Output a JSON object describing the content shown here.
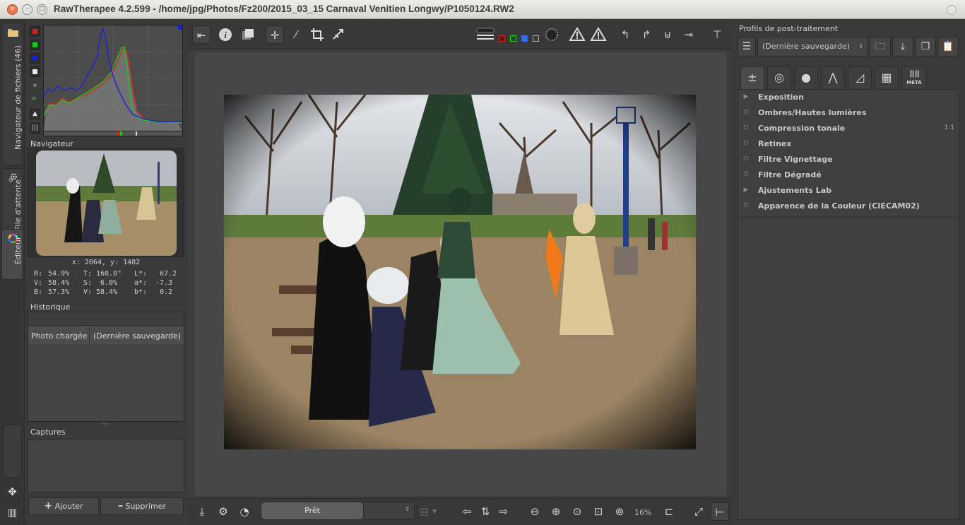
{
  "window": {
    "title": "RawTherapee 4.2.599 - /home/jpg/Photos/Fz200/2015_03_15 Carnaval Venitien Longwy/P1050124.RW2",
    "close_glyph": "×",
    "minimize_glyph": "–",
    "maximize_glyph": "□"
  },
  "vertical_tabs": [
    {
      "label": "Navigateur de fichiers  (46)",
      "icon": "folder-icon"
    },
    {
      "label": "File d'attente",
      "icon": "gears-icon"
    },
    {
      "label": "Éditeur",
      "icon": "color-wheel-icon"
    }
  ],
  "left_panel": {
    "navigator_title": "Navigateur",
    "coords": "x: 2064, y: 1482",
    "info": [
      [
        "R:",
        "54.9%",
        "T:",
        "160.0°",
        "L*:",
        "67.2"
      ],
      [
        "V:",
        "58.4%",
        "S:",
        "6.0%",
        "a*:",
        "-7.3"
      ],
      [
        "B:",
        "57.3%",
        "V:",
        "58.4%",
        "b*:",
        "0.2"
      ]
    ],
    "history_title": "Historique",
    "history_rows": [
      {
        "action": "Photo chargée",
        "value": "(Dernière sauvegarde)"
      }
    ],
    "snapshots_title": "Captures",
    "add_button": "Ajouter",
    "remove_button": "Supprimer"
  },
  "histogram_colors": {
    "red": "#d82020",
    "green": "#22c422",
    "blue": "#1a22d8",
    "luminance": "#e8e8e8"
  },
  "center": {
    "progress_label": "Prêt",
    "zoom_label": "16%"
  },
  "right_panel": {
    "profiles_title": "Profils de post-traitement",
    "profile_value": "(Dernière sauvegarde)",
    "meta_tab_label": "META",
    "tools": [
      {
        "label": "Exposition",
        "icon": "expander-triangle-icon",
        "badge": ""
      },
      {
        "label": "Ombres/Hautes lumières",
        "icon": "power-toggle-icon",
        "badge": ""
      },
      {
        "label": "Compression tonale",
        "icon": "power-toggle-icon",
        "badge": "1:1"
      },
      {
        "label": "Retinex",
        "icon": "power-toggle-icon",
        "badge": ""
      },
      {
        "label": "Filtre Vignettage",
        "icon": "power-toggle-icon",
        "badge": ""
      },
      {
        "label": "Filtre Dégradé",
        "icon": "power-toggle-icon",
        "badge": ""
      },
      {
        "label": "Ajustements Lab",
        "icon": "expander-triangle-icon",
        "badge": ""
      },
      {
        "label": "Apparence de la Couleur (CIECAM02)",
        "icon": "power-toggle-icon",
        "badge": ""
      }
    ]
  }
}
